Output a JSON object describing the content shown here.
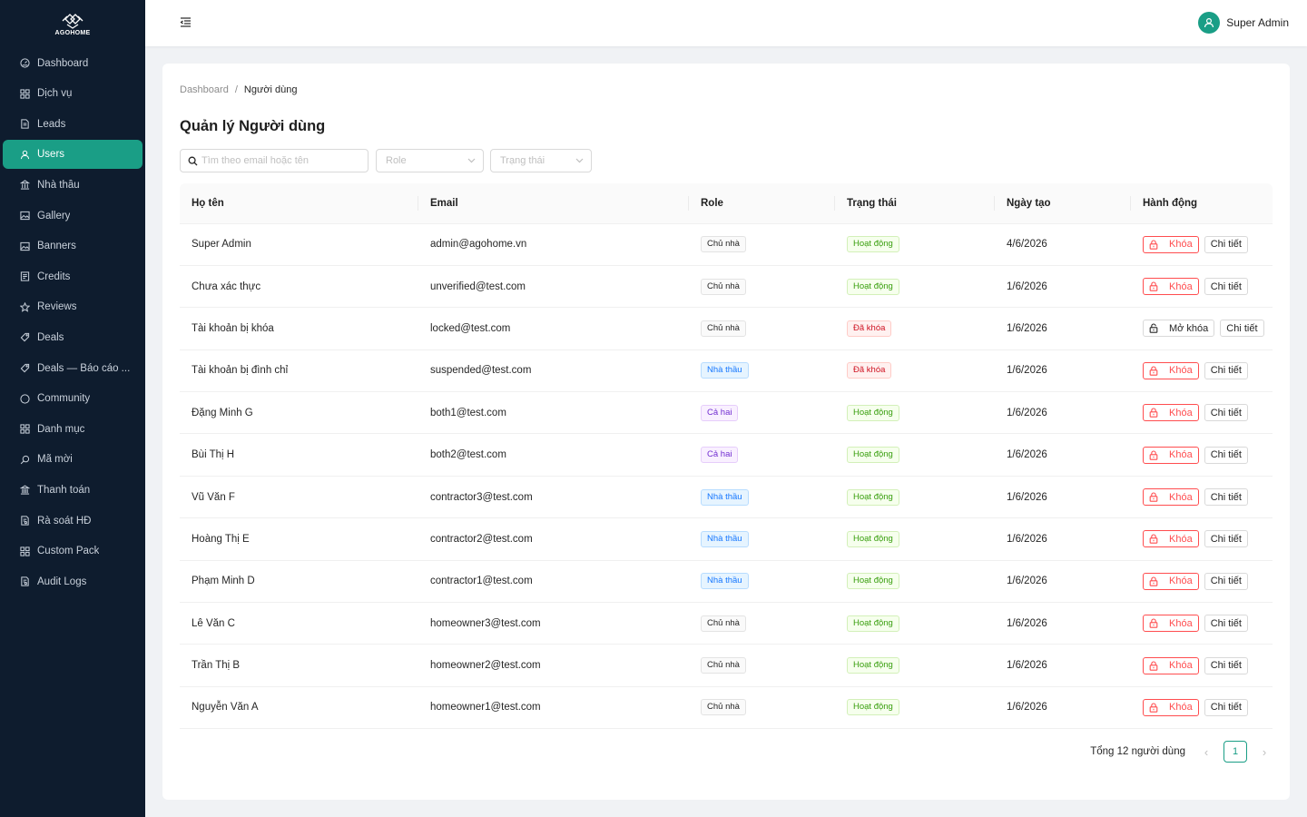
{
  "brand": {
    "name": "AGOHOME",
    "accent": "#1a9e86",
    "sidebar_bg": "#0e1c2e"
  },
  "sidebar": {
    "items": [
      {
        "label": "Dashboard",
        "icon": "dashboard-icon",
        "active": false
      },
      {
        "label": "Dịch vụ",
        "icon": "grid-icon",
        "active": false
      },
      {
        "label": "Leads",
        "icon": "file-icon",
        "active": false
      },
      {
        "label": "Users",
        "icon": "user-icon",
        "active": true
      },
      {
        "label": "Nhà thầu",
        "icon": "building-icon",
        "active": false
      },
      {
        "label": "Gallery",
        "icon": "picture-icon",
        "active": false
      },
      {
        "label": "Banners",
        "icon": "picture-icon",
        "active": false
      },
      {
        "label": "Credits",
        "icon": "wallet-icon",
        "active": false
      },
      {
        "label": "Reviews",
        "icon": "star-icon",
        "active": false
      },
      {
        "label": "Deals",
        "icon": "tag-icon",
        "active": false
      },
      {
        "label": "Deals — Báo cáo ...",
        "icon": "tag-icon",
        "active": false
      },
      {
        "label": "Community",
        "icon": "chat-icon",
        "active": false
      },
      {
        "label": "Danh mục",
        "icon": "grid-icon",
        "active": false
      },
      {
        "label": "Mã mời",
        "icon": "search-icon",
        "active": false
      },
      {
        "label": "Thanh toán",
        "icon": "bank-icon",
        "active": false
      },
      {
        "label": "Rà soát HĐ",
        "icon": "audit-icon",
        "active": false
      },
      {
        "label": "Custom Pack",
        "icon": "grid-icon",
        "active": false
      },
      {
        "label": "Audit Logs",
        "icon": "audit-icon",
        "active": false
      }
    ]
  },
  "header": {
    "user_name": "Super Admin"
  },
  "breadcrumb": {
    "root": "Dashboard",
    "separator": "/",
    "current": "Người dùng"
  },
  "page_title": "Quản lý Người dùng",
  "filters": {
    "search_placeholder": "Tìm theo email hoặc tên",
    "role_placeholder": "Role",
    "status_placeholder": "Trạng thái"
  },
  "table": {
    "columns": [
      "Họ tên",
      "Email",
      "Role",
      "Trạng thái",
      "Ngày tạo",
      "Hành động"
    ],
    "rows": [
      {
        "name": "Super Admin",
        "email": "admin@agohome.vn",
        "role": "Chủ nhà",
        "role_type": "gray",
        "status": "Hoạt động",
        "status_type": "green",
        "created": "4/6/2026",
        "action": "Khóa",
        "action_type": "lock",
        "detail": "Chi tiết"
      },
      {
        "name": "Chưa xác thực",
        "email": "unverified@test.com",
        "role": "Chủ nhà",
        "role_type": "gray",
        "status": "Hoạt động",
        "status_type": "green",
        "created": "1/6/2026",
        "action": "Khóa",
        "action_type": "lock",
        "detail": "Chi tiết"
      },
      {
        "name": "Tài khoản bị khóa",
        "email": "locked@test.com",
        "role": "Chủ nhà",
        "role_type": "gray",
        "status": "Đã khóa",
        "status_type": "red",
        "created": "1/6/2026",
        "action": "Mở khóa",
        "action_type": "unlock",
        "detail": "Chi tiết"
      },
      {
        "name": "Tài khoản bị đình chỉ",
        "email": "suspended@test.com",
        "role": "Nhà thầu",
        "role_type": "blue",
        "status": "Đã khóa",
        "status_type": "red",
        "created": "1/6/2026",
        "action": "Khóa",
        "action_type": "lock",
        "detail": "Chi tiết"
      },
      {
        "name": "Đặng Minh G",
        "email": "both1@test.com",
        "role": "Cả hai",
        "role_type": "purple",
        "status": "Hoạt động",
        "status_type": "green",
        "created": "1/6/2026",
        "action": "Khóa",
        "action_type": "lock",
        "detail": "Chi tiết"
      },
      {
        "name": "Bùi Thị H",
        "email": "both2@test.com",
        "role": "Cả hai",
        "role_type": "purple",
        "status": "Hoạt động",
        "status_type": "green",
        "created": "1/6/2026",
        "action": "Khóa",
        "action_type": "lock",
        "detail": "Chi tiết"
      },
      {
        "name": "Vũ Văn F",
        "email": "contractor3@test.com",
        "role": "Nhà thầu",
        "role_type": "blue",
        "status": "Hoạt động",
        "status_type": "green",
        "created": "1/6/2026",
        "action": "Khóa",
        "action_type": "lock",
        "detail": "Chi tiết"
      },
      {
        "name": "Hoàng Thị E",
        "email": "contractor2@test.com",
        "role": "Nhà thầu",
        "role_type": "blue",
        "status": "Hoạt động",
        "status_type": "green",
        "created": "1/6/2026",
        "action": "Khóa",
        "action_type": "lock",
        "detail": "Chi tiết"
      },
      {
        "name": "Phạm Minh D",
        "email": "contractor1@test.com",
        "role": "Nhà thầu",
        "role_type": "blue",
        "status": "Hoạt động",
        "status_type": "green",
        "created": "1/6/2026",
        "action": "Khóa",
        "action_type": "lock",
        "detail": "Chi tiết"
      },
      {
        "name": "Lê Văn C",
        "email": "homeowner3@test.com",
        "role": "Chủ nhà",
        "role_type": "gray",
        "status": "Hoạt động",
        "status_type": "green",
        "created": "1/6/2026",
        "action": "Khóa",
        "action_type": "lock",
        "detail": "Chi tiết"
      },
      {
        "name": "Trần Thị B",
        "email": "homeowner2@test.com",
        "role": "Chủ nhà",
        "role_type": "gray",
        "status": "Hoạt động",
        "status_type": "green",
        "created": "1/6/2026",
        "action": "Khóa",
        "action_type": "lock",
        "detail": "Chi tiết"
      },
      {
        "name": "Nguyễn Văn A",
        "email": "homeowner1@test.com",
        "role": "Chủ nhà",
        "role_type": "gray",
        "status": "Hoạt động",
        "status_type": "green",
        "created": "1/6/2026",
        "action": "Khóa",
        "action_type": "lock",
        "detail": "Chi tiết"
      }
    ]
  },
  "pagination": {
    "total_text": "Tổng 12 người dùng",
    "current_page": "1",
    "prev": "‹",
    "next": "›"
  }
}
